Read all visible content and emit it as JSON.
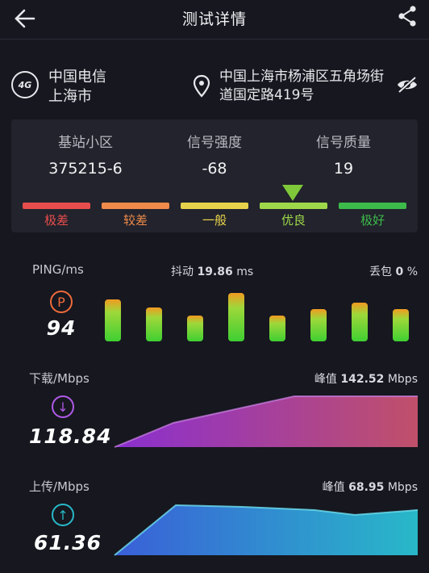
{
  "header": {
    "title": "测试详情",
    "back_icon": "arrow-left-icon",
    "share_icon": "share-icon"
  },
  "carrier": {
    "badge": "4G",
    "name": "中国电信",
    "city": "上海市",
    "address": "中国上海市杨浦区五角场街道国定路419号"
  },
  "signal": {
    "columns": [
      {
        "label": "基站小区",
        "value": "375215-6"
      },
      {
        "label": "信号强度",
        "value": "-68"
      },
      {
        "label": "信号质量",
        "value": "19"
      }
    ],
    "levels": [
      {
        "label": "极差",
        "color": "#e84d4d"
      },
      {
        "label": "较差",
        "color": "#ef8a4a"
      },
      {
        "label": "一般",
        "color": "#e7d34b"
      },
      {
        "label": "优良",
        "color": "#9ed84a"
      },
      {
        "label": "极好",
        "color": "#3dbb4a"
      }
    ],
    "current_level": "优良"
  },
  "ping": {
    "label": "PING/ms",
    "icon_letter": "P",
    "value": "94",
    "jitter_label": "抖动",
    "jitter_value": "19.86",
    "jitter_unit": "ms",
    "loss_label": "丢包",
    "loss_value": "0",
    "loss_unit": "%",
    "bars": [
      52,
      42,
      32,
      60,
      32,
      40,
      48,
      40
    ]
  },
  "download": {
    "label": "下载/Mbps",
    "value": "118.84",
    "peak_label": "峰值",
    "peak_value": "142.52",
    "peak_unit": "Mbps",
    "colors": [
      "#8a2fd0",
      "#c0506a"
    ]
  },
  "upload": {
    "label": "上传/Mbps",
    "value": "61.36",
    "peak_label": "峰值",
    "peak_value": "68.95",
    "peak_unit": "Mbps",
    "colors": [
      "#3a5fd8",
      "#28b8c8"
    ]
  }
}
